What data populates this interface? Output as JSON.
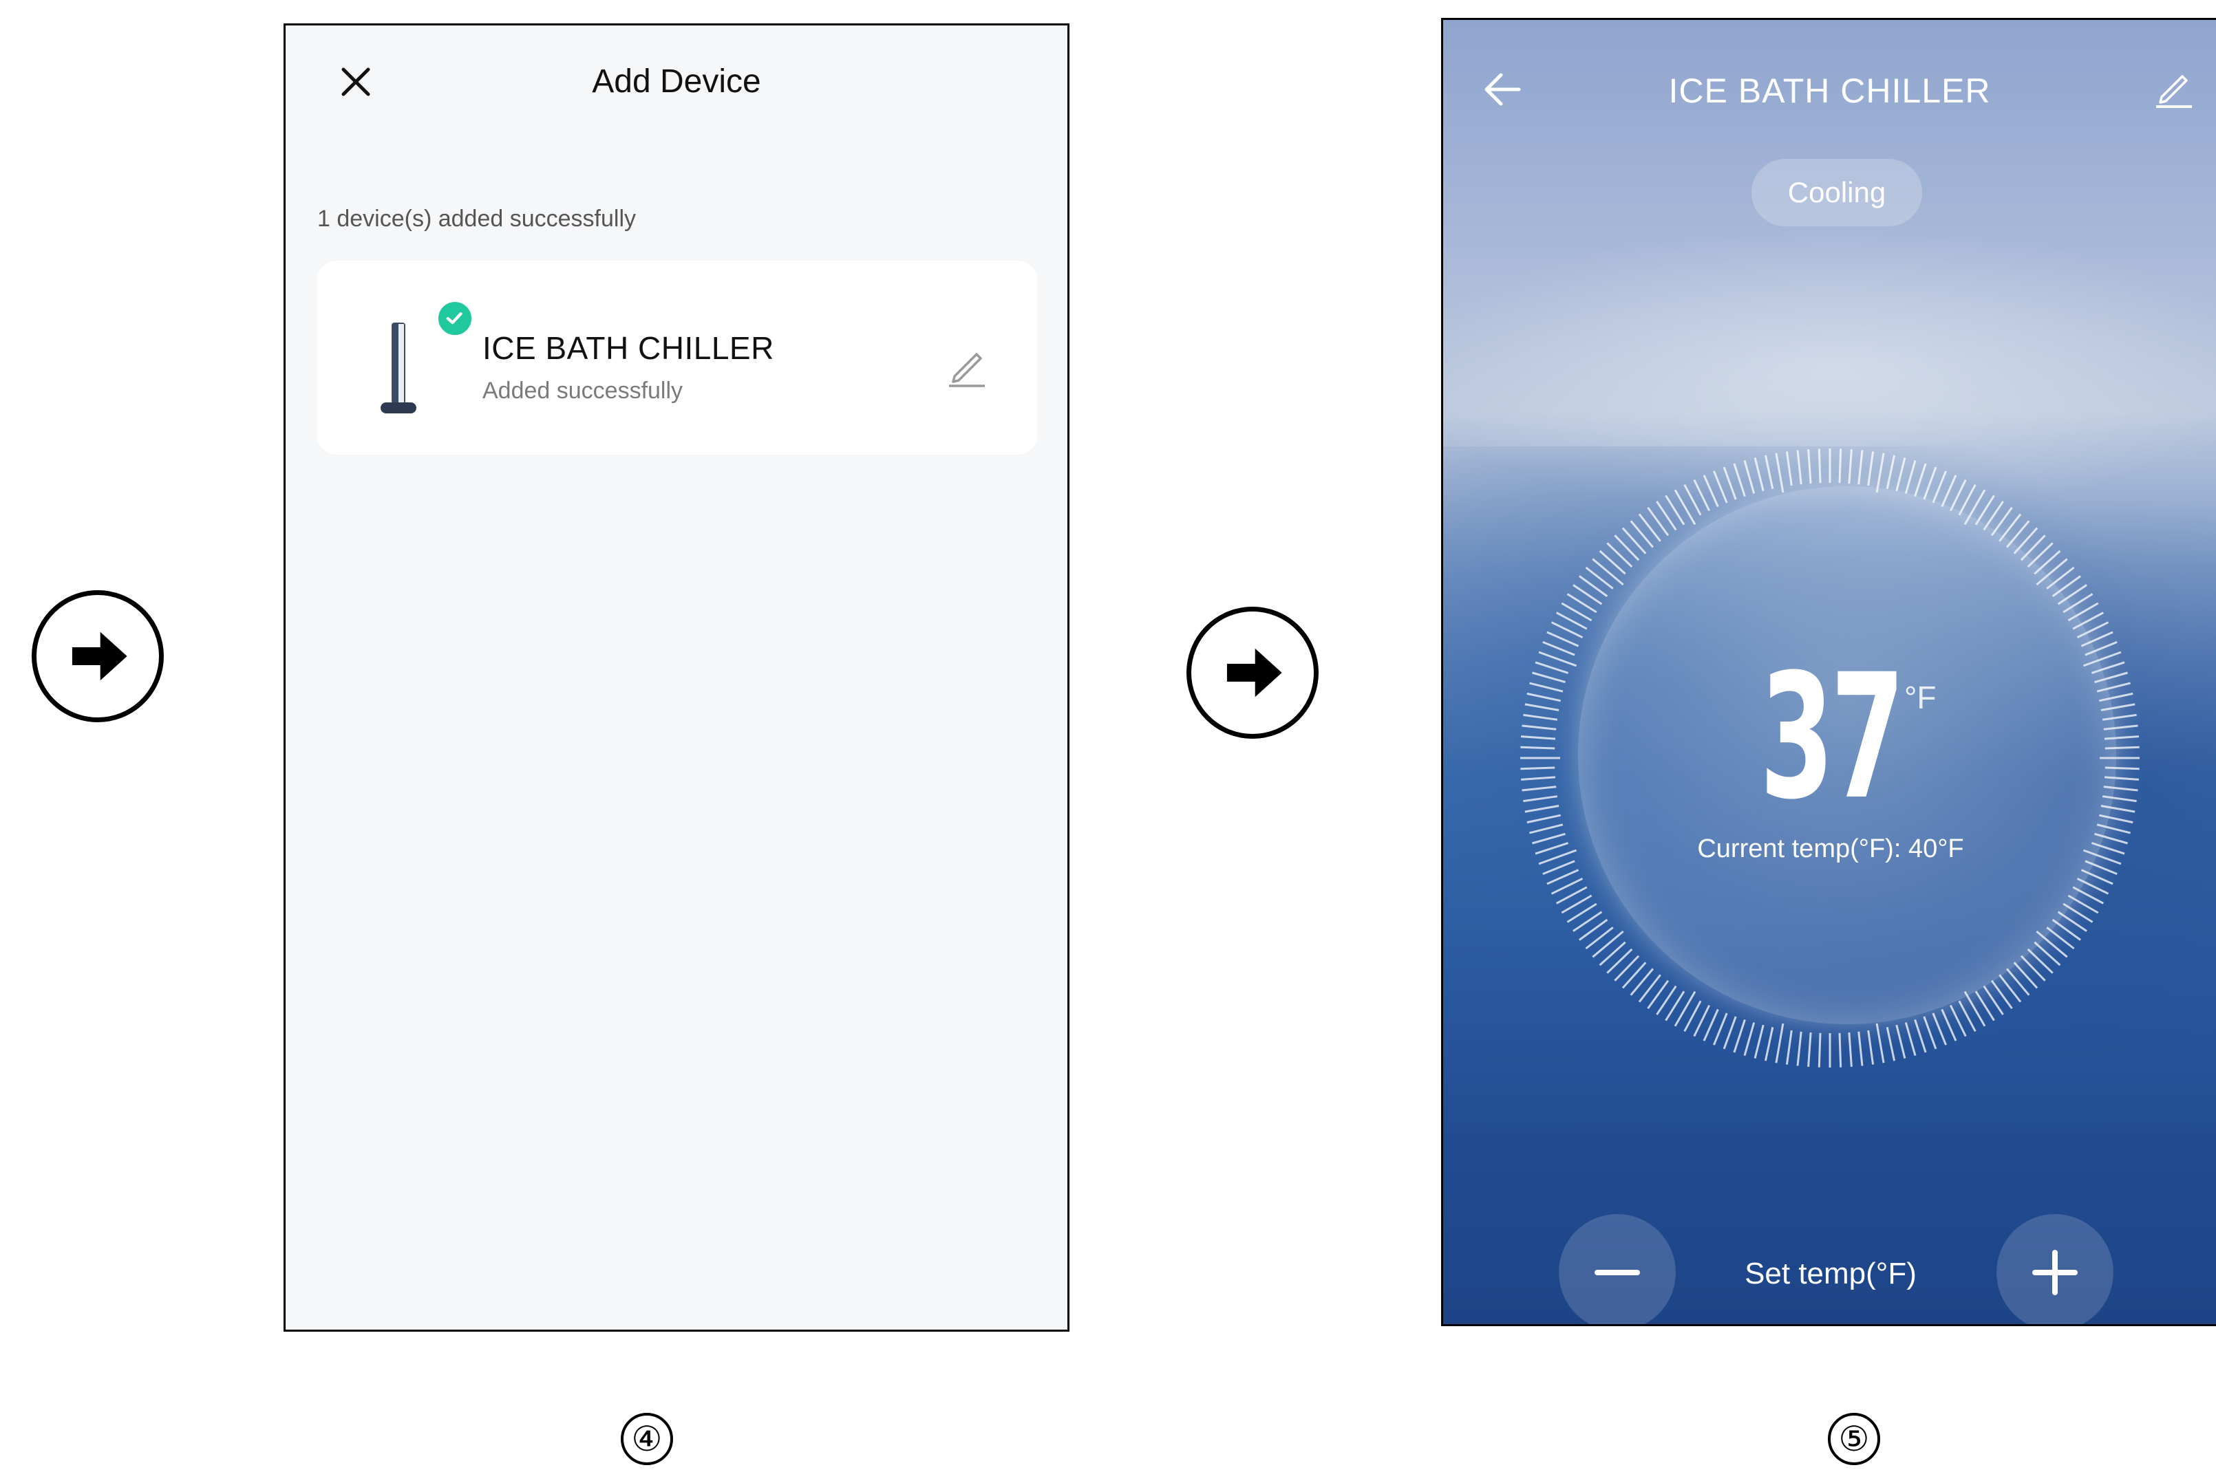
{
  "steps": {
    "step4": "④",
    "step5": "⑤"
  },
  "icons": {
    "flow_arrow": "arrow-right-circle-icon",
    "close": "close-icon",
    "check": "check-circle-icon",
    "edit": "pencil-icon",
    "back": "arrow-left-icon",
    "minus": "minus-icon",
    "plus": "plus-icon"
  },
  "colors": {
    "success_green": "#1fc99d",
    "screen4_bg": "#f6f7f9",
    "screen5_sky": "#8fa5cf",
    "screen5_water": "#1d4487"
  },
  "add_device_screen": {
    "title": "Add Device",
    "status": "1 device(s) added successfully",
    "device": {
      "name": "ICE  BATH CHILLER",
      "subtitle": "Added successfully"
    }
  },
  "control_screen": {
    "title": "ICE  BATH CHILLER",
    "mode": "Cooling",
    "set_temp_value": "37",
    "unit": "°F",
    "current_temp": "Current temp(°F): 40°F",
    "set_temp_label": "Set temp(°F)"
  }
}
